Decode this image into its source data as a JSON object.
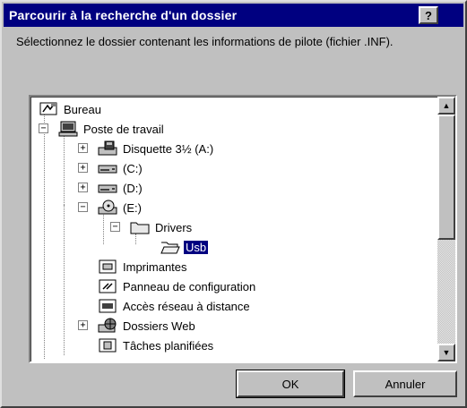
{
  "title": "Parcourir à la recherche d'un dossier",
  "help_label": "?",
  "instruction": "Sélectionnez le dossier contenant les informations de pilote (fichier .INF).",
  "tree": [
    {
      "label": "Bureau",
      "icon": "desktop-icon",
      "expander": "−",
      "selected": false
    },
    {
      "label": "Poste de travail",
      "icon": "computer-icon",
      "expander": "−",
      "selected": false
    },
    {
      "label": "Disquette 3½ (A:)",
      "icon": "floppy-drive-icon",
      "expander": "+",
      "selected": false
    },
    {
      "label": "(C:)",
      "icon": "hard-drive-icon",
      "expander": "+",
      "selected": false
    },
    {
      "label": "(D:)",
      "icon": "hard-drive-icon",
      "expander": "+",
      "selected": false
    },
    {
      "label": "(E:)",
      "icon": "cd-drive-icon",
      "expander": "−",
      "selected": false
    },
    {
      "label": "Drivers",
      "icon": "folder-icon",
      "expander": "−",
      "selected": false
    },
    {
      "label": "Usb",
      "icon": "open-folder-icon",
      "expander": "",
      "selected": true
    },
    {
      "label": "Imprimantes",
      "icon": "printers-folder-icon",
      "expander": "",
      "selected": false
    },
    {
      "label": "Panneau de configuration",
      "icon": "control-panel-icon",
      "expander": "",
      "selected": false
    },
    {
      "label": "Accès réseau à distance",
      "icon": "dialup-networking-icon",
      "expander": "",
      "selected": false
    },
    {
      "label": "Dossiers Web",
      "icon": "web-folders-icon",
      "expander": "+",
      "selected": false
    },
    {
      "label": "Tâches planifiées",
      "icon": "scheduled-tasks-icon",
      "expander": "",
      "selected": false
    }
  ],
  "buttons": {
    "ok": "OK",
    "cancel": "Annuler"
  },
  "scroll_up": "▲",
  "scroll_down": "▼"
}
